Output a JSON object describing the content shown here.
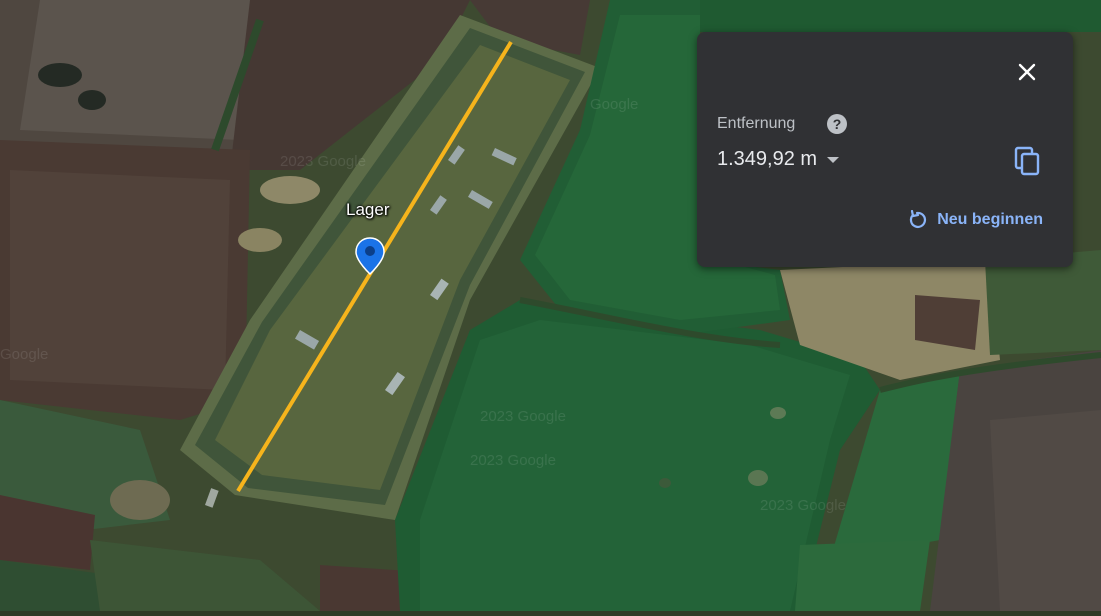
{
  "map": {
    "place_label": "Lager",
    "watermarks": [
      "Google",
      "2023 Google",
      "2023 Google",
      "2023 Google",
      "Google",
      "2023 Google"
    ],
    "measure_line_color": "#f6b41c",
    "pin_color": "#1a73e8"
  },
  "panel": {
    "distance_label": "Entfernung",
    "help_icon": "?",
    "distance_value": "1.349,92 m",
    "restart_label": "Neu beginnen",
    "accent_color": "#8ab4f8"
  }
}
